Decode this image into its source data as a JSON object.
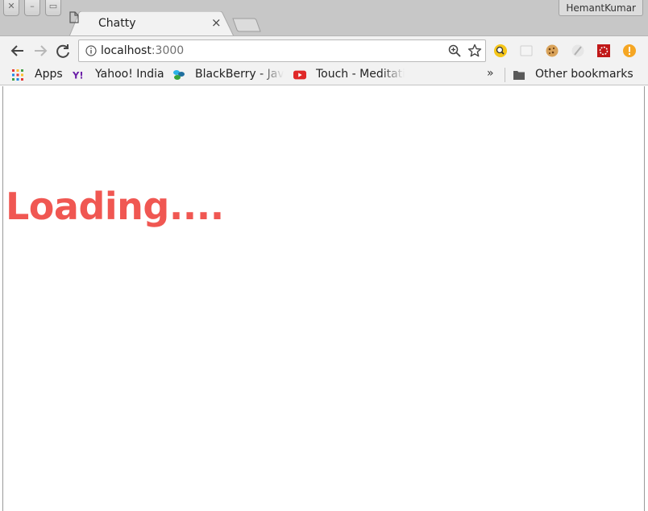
{
  "window": {
    "profile_name": "HemantKumar"
  },
  "tabs": [
    {
      "title": "Chatty",
      "close_glyph": "×",
      "icon": "document-icon"
    }
  ],
  "toolbar": {
    "url_host": "localhost",
    "url_port": ":3000",
    "icons": [
      "back-arrow-icon",
      "forward-arrow-icon",
      "reload-icon",
      "info-icon",
      "zoom-icon",
      "star-icon"
    ],
    "extensions": [
      "search-extension-icon",
      "blank-extension-icon",
      "cookie-extension-icon",
      "feather-extension-icon",
      "red-extension-icon",
      "warning-extension-icon"
    ]
  },
  "bookmarks": {
    "items": [
      {
        "label": "Apps",
        "icon": "apps-grid-icon"
      },
      {
        "label": "Yahoo! India",
        "icon": "yahoo-icon"
      },
      {
        "label": "BlackBerry - Jav",
        "icon": "blackberry-icon"
      },
      {
        "label": "Touch - Meditati",
        "icon": "youtube-icon"
      }
    ],
    "overflow_glyph": "»",
    "other_label": "Other bookmarks",
    "other_icon": "folder-icon"
  },
  "page": {
    "loading_text": "Loading....",
    "loading_color": "#f05752"
  }
}
